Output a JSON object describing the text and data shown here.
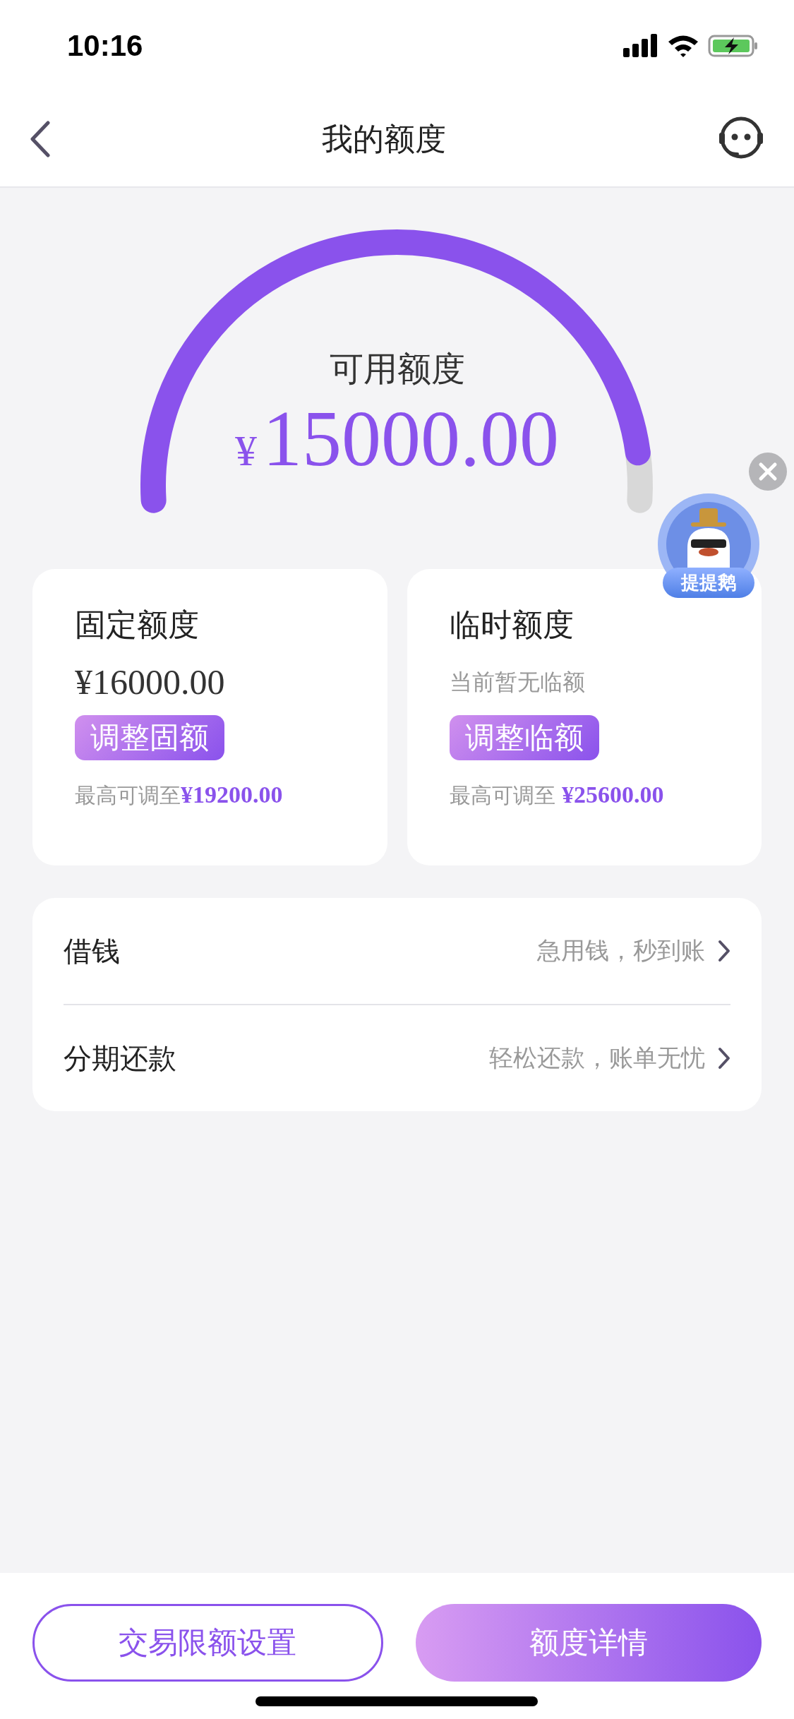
{
  "status_bar": {
    "time": "10:16"
  },
  "nav": {
    "title": "我的额度"
  },
  "gauge": {
    "label": "可用额度",
    "currency": "¥",
    "amount": "15000.00"
  },
  "cards": [
    {
      "title": "固定额度",
      "amount": "¥16000.00",
      "kind": "amount",
      "button": "调整固额",
      "max_note": "最高可调至**¥19200.00**"
    },
    {
      "title": "临时额度",
      "note": "当前暂无临额",
      "kind": "note",
      "button": "调整临额",
      "max_note": "最高可调至 **¥25600.00**"
    }
  ],
  "menu": [
    {
      "label": "借钱",
      "hint": "急用钱，秒到账"
    },
    {
      "label": "分期还款",
      "hint": "轻松还款，账单无忧"
    }
  ],
  "floating_badge": {
    "label": "提提鹅"
  },
  "bottom_buttons": [
    {
      "label": "交易限额设置",
      "kind": "outline"
    },
    {
      "label": "额度详情",
      "kind": "filled"
    }
  ]
}
